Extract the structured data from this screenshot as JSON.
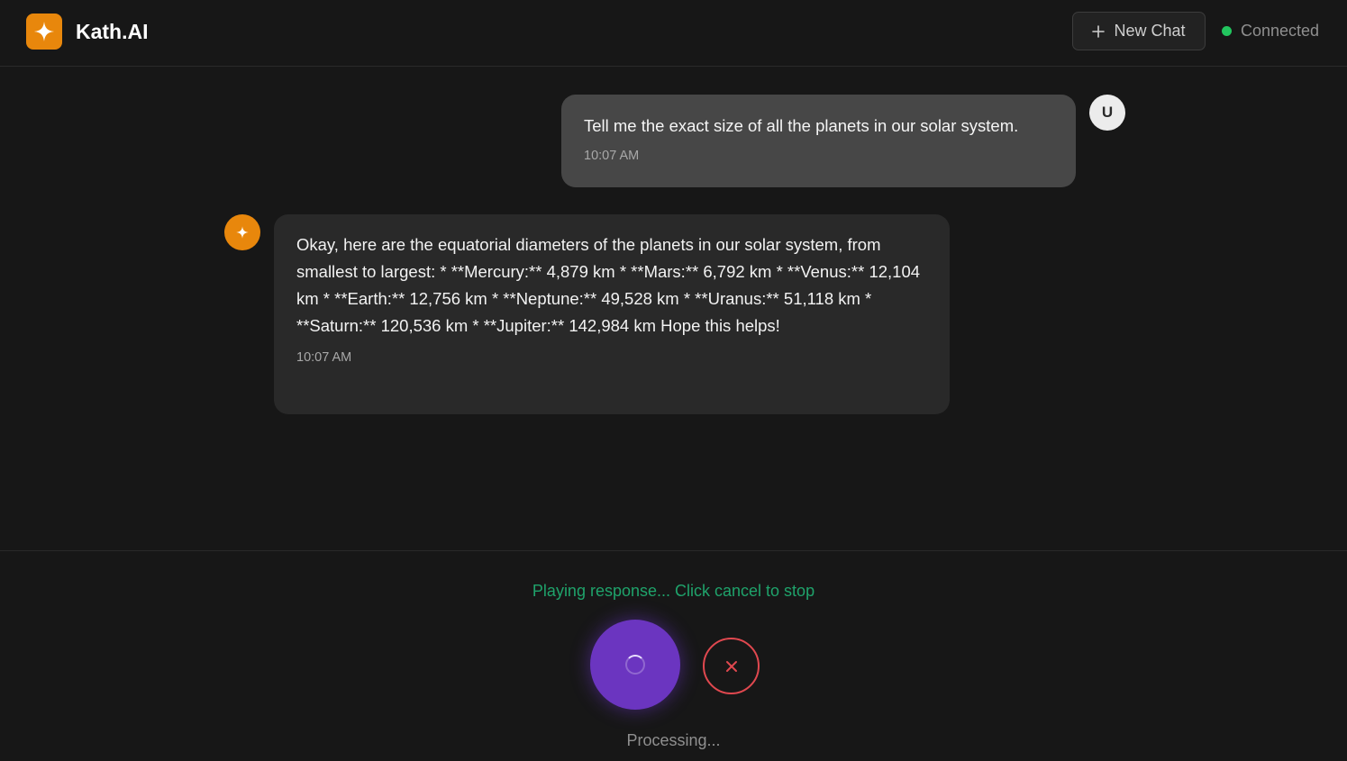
{
  "header": {
    "app_name": "Kath.AI",
    "new_chat_label": "New Chat",
    "status_label": "Connected"
  },
  "messages": [
    {
      "role": "user",
      "avatar_letter": "U",
      "text": "Tell me the exact size of all the planets in our solar system.",
      "time": "10:07 AM"
    },
    {
      "role": "assistant",
      "text": "Okay, here are the equatorial diameters of the planets in our solar system, from smallest to largest: * **Mercury:** 4,879 km * **Mars:** 6,792 km * **Venus:** 12,104 km * **Earth:** 12,756 km * **Neptune:** 49,528 km * **Uranus:** 51,118 km * **Saturn:** 120,536 km * **Jupiter:** 142,984 km Hope this helps!",
      "time": "10:07 AM"
    }
  ],
  "voice_controls": {
    "playing_text": "Playing response... Click cancel to stop",
    "processing_text": "Processing..."
  },
  "colors": {
    "accent": "#e8870c",
    "mic": "#6b35c0",
    "cancel": "#e0484f",
    "status": "#22c55e"
  }
}
